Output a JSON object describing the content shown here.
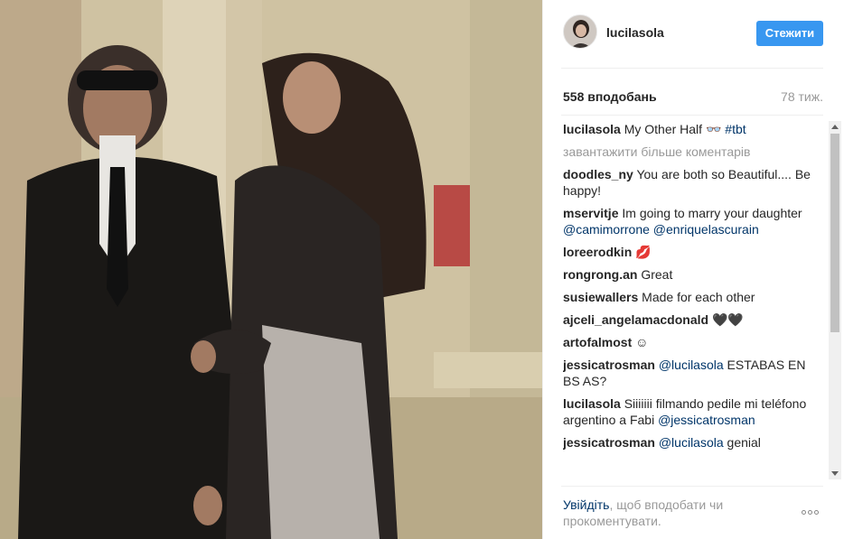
{
  "header": {
    "username": "lucilasola",
    "follow_label": "Стежити"
  },
  "stats": {
    "likes": "558 вподобань",
    "time": "78 тиж."
  },
  "caption": {
    "user": "lucilasola",
    "text": "My Other Half 👓",
    "tag": "#tbt"
  },
  "load_more": "завантажити більше коментарів",
  "comments": [
    {
      "user": "doodles_ny",
      "text": "You are both so Beautiful.... Be happy!"
    },
    {
      "user": "mservitje",
      "text": "Im going to marry your daughter",
      "mention1": "@camimorrone",
      "mention2": "@enriquelascurain"
    },
    {
      "user": "loreerodkin",
      "text": "💋"
    },
    {
      "user": "rongrong.an",
      "text": "Great"
    },
    {
      "user": "susiewallers",
      "text": "Made for each other"
    },
    {
      "user": "ajceli_angelamacdonald",
      "text": "🖤🖤"
    },
    {
      "user": "artofalmost",
      "text": "☺"
    },
    {
      "user": "jessicatrosman",
      "mention1": "@lucilasola",
      "text": "ESTABAS EN BS AS?"
    },
    {
      "user": "lucilasola",
      "text": "Siiiiiii filmando pedile mi teléfono argentino a Fabi",
      "mention1": "@jessicatrosman"
    },
    {
      "user": "jessicatrosman",
      "mention1": "@lucilasola",
      "text": "genial"
    }
  ],
  "footer": {
    "login_link": "Увійдіть",
    "login_text": ", щоб вподобати чи прокоментувати."
  },
  "icons": {
    "more": "more-options-icon",
    "avatar": "avatar"
  },
  "colors": {
    "accent": "#3897f0",
    "link": "#003569",
    "muted": "#999999"
  }
}
